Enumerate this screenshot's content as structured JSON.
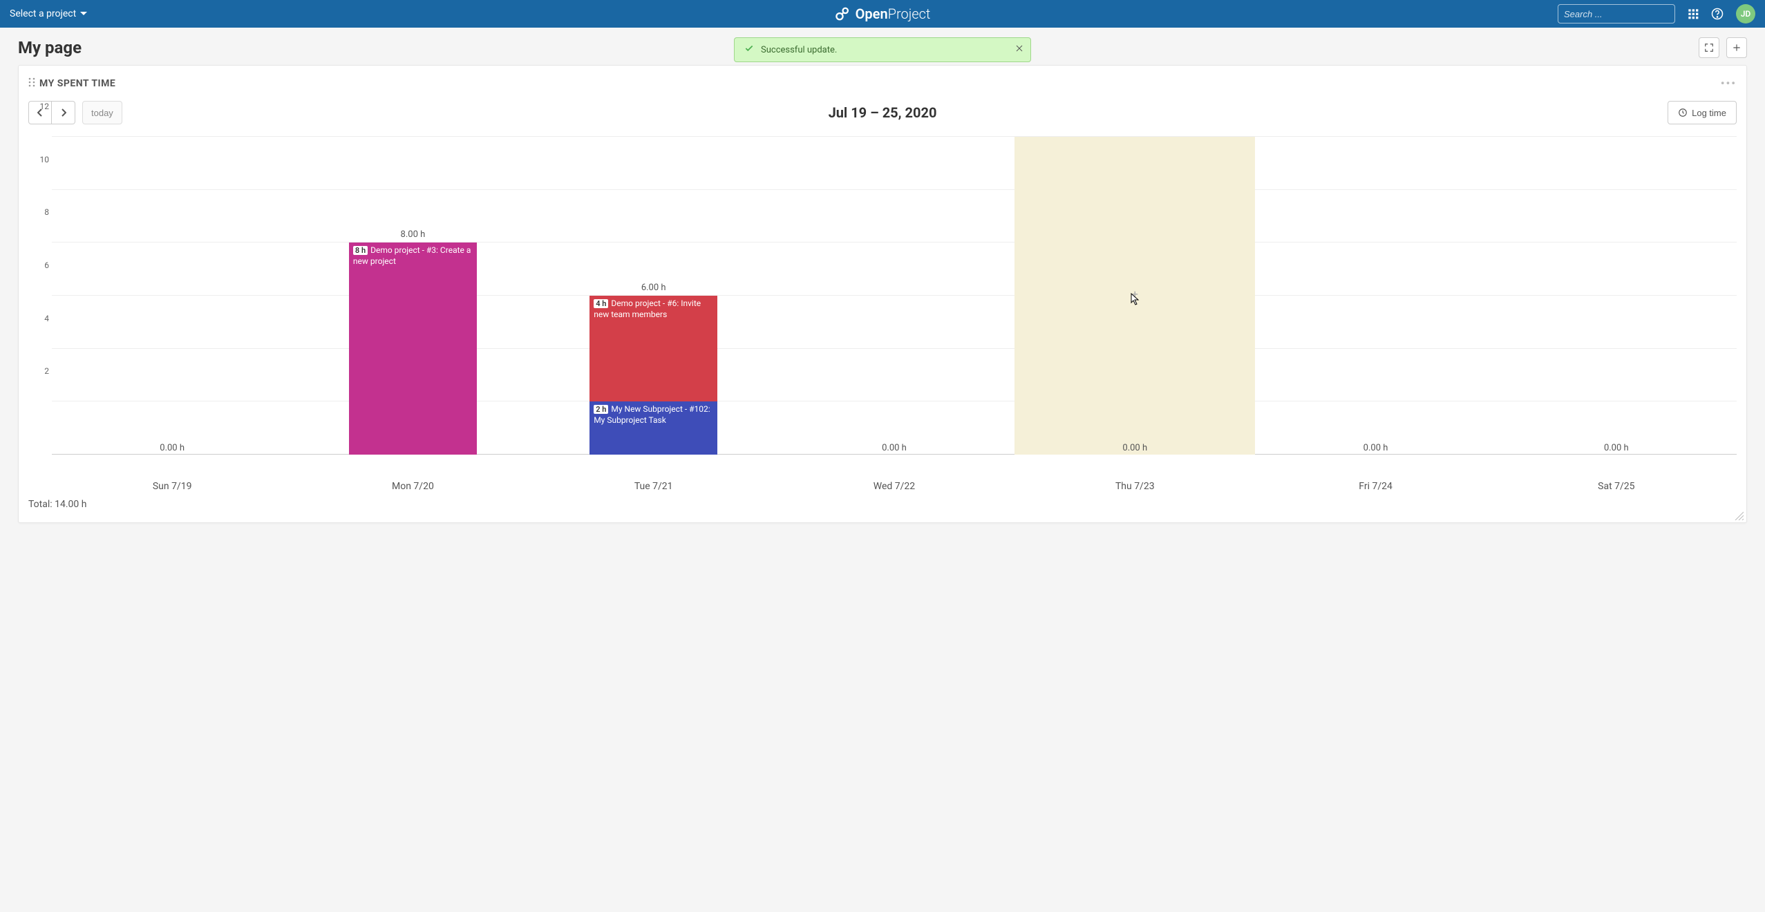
{
  "header": {
    "project_select": "Select a project",
    "brand_open": "Open",
    "brand_project": "Project",
    "search_placeholder": "Search ...",
    "avatar_initials": "JD"
  },
  "page": {
    "title": "My page",
    "toast_message": "Successful update."
  },
  "widget": {
    "title": "MY SPENT TIME",
    "today_btn": "today",
    "log_time_btn": "Log time",
    "range_label": "Jul 19 – 25, 2020",
    "total_label": "Total: 14.00 h"
  },
  "chart_data": {
    "type": "bar",
    "ylabel": "",
    "xlabel": "",
    "ylim": [
      0,
      12
    ],
    "y_ticks": [
      2,
      4,
      6,
      8,
      10,
      12
    ],
    "categories": [
      "Sun 7/19",
      "Mon 7/20",
      "Tue 7/21",
      "Wed 7/22",
      "Thu 7/23",
      "Fri 7/24",
      "Sat 7/25"
    ],
    "series": [
      {
        "day_index": 0,
        "total_h": 0.0,
        "segments": []
      },
      {
        "day_index": 1,
        "total_h": 8.0,
        "segments": [
          {
            "hours": 8,
            "label": "Demo project - #3: Create a new project",
            "color": "#c3318f"
          }
        ]
      },
      {
        "day_index": 2,
        "total_h": 6.0,
        "segments": [
          {
            "hours": 2,
            "label": "My New Subproject - #102: My Subproject Task",
            "color": "#3e4db8"
          },
          {
            "hours": 4,
            "label": "Demo project - #6: Invite new team members",
            "color": "#d33f49"
          }
        ]
      },
      {
        "day_index": 3,
        "total_h": 0.0,
        "segments": []
      },
      {
        "day_index": 4,
        "total_h": 0.0,
        "segments": [],
        "hovered": true
      },
      {
        "day_index": 5,
        "total_h": 0.0,
        "segments": []
      },
      {
        "day_index": 6,
        "total_h": 0.0,
        "segments": []
      }
    ]
  }
}
